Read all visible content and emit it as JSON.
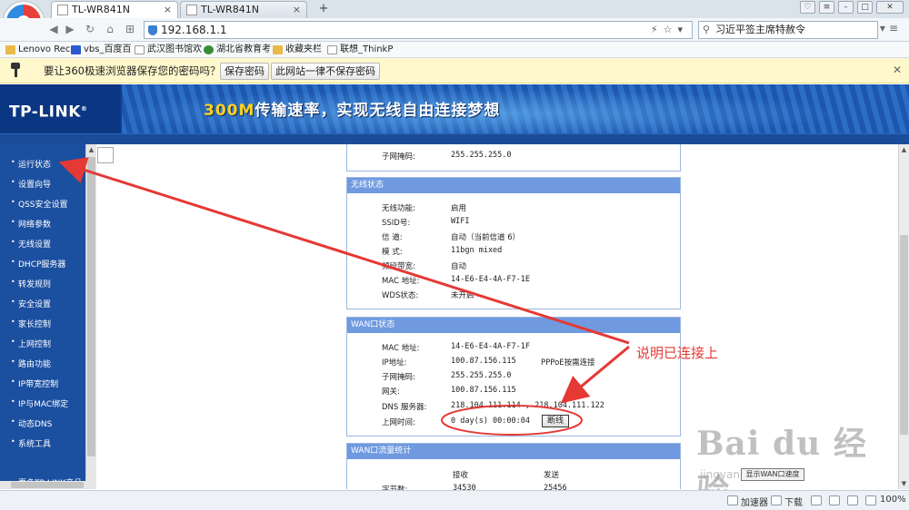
{
  "browser": {
    "tabs": [
      {
        "label": "TL-WR841N",
        "active": true
      },
      {
        "label": "TL-WR841N",
        "active": false
      }
    ],
    "new_tab": "+",
    "url": "192.168.1.1",
    "search_text": "习近平签主席特赦令",
    "bookmarks": [
      "Lenovo Rec",
      "vbs_百度百",
      "武汉图书馆欢",
      "湖北省教育考",
      "收藏夹栏",
      "联想_ThinkP"
    ],
    "password_bar": {
      "message": "要让360极速浏览器保存您的密码吗？",
      "save_button": "保存密码",
      "never_button": "此网站一律不保存密码"
    }
  },
  "router": {
    "brand": "TP-LINK",
    "slogan_highlight": "300M",
    "slogan_rest": "传输速率，实现无线自由连接梦想",
    "menu": [
      "运行状态",
      "设置向导",
      "QSS安全设置",
      "网络参数",
      "无线设置",
      "DHCP服务器",
      "转发规则",
      "安全设置",
      "家长控制",
      "上网控制",
      "路由功能",
      "IP带宽控制",
      "IP与MAC绑定",
      "动态DNS",
      "系统工具",
      "更多TP-LINK产品"
    ],
    "top_panel": {
      "label": "子网掩码:",
      "value": "255.255.255.0"
    },
    "wireless": {
      "title": "无线状态",
      "rows": [
        {
          "label": "无线功能:",
          "value": "启用"
        },
        {
          "label": "SSID号:",
          "value": "WIFI"
        },
        {
          "label": "信 道:",
          "value": "自动（当前信道 6）"
        },
        {
          "label": "模 式:",
          "value": "11bgn mixed"
        },
        {
          "label": "频段带宽:",
          "value": "自动"
        },
        {
          "label": "MAC 地址:",
          "value": "14-E6-E4-4A-F7-1E"
        },
        {
          "label": "WDS状态:",
          "value": "未开启"
        }
      ]
    },
    "wan": {
      "title": "WAN口状态",
      "rows": [
        {
          "label": "MAC 地址:",
          "value": "14-E6-E4-4A-F7-1F"
        },
        {
          "label": "IP地址:",
          "value": "100.87.156.115"
        },
        {
          "label": "子网掩码:",
          "value": "255.255.255.0"
        },
        {
          "label": "网关:",
          "value": "100.87.156.115"
        },
        {
          "label": "DNS 服务器:",
          "value": "218.104.111.114 , 218.104.111.122"
        },
        {
          "label": "上网时间:",
          "value": "0 day(s) 00:00:04"
        }
      ],
      "connection_type": "PPPoE按需连接",
      "disconnect_button": "断线"
    },
    "traffic": {
      "title": "WAN口流量统计",
      "col_received": "接收",
      "col_sent": "发送",
      "row_label": "字节数:",
      "received": "34530",
      "sent": "25456"
    }
  },
  "annotation": "说明已连接上",
  "watermark": {
    "big": "Bai du 经验",
    "small": "jingyan.baidu.com"
  },
  "float_button": "显示WAN口速度",
  "statusbar": {
    "accelerator": "加速器",
    "download": "下载",
    "zoom": "100%"
  },
  "colors": {
    "router_blue": "#1b4fa0",
    "panel_head": "#6f9ae0",
    "annotation_red": "#e53935"
  }
}
